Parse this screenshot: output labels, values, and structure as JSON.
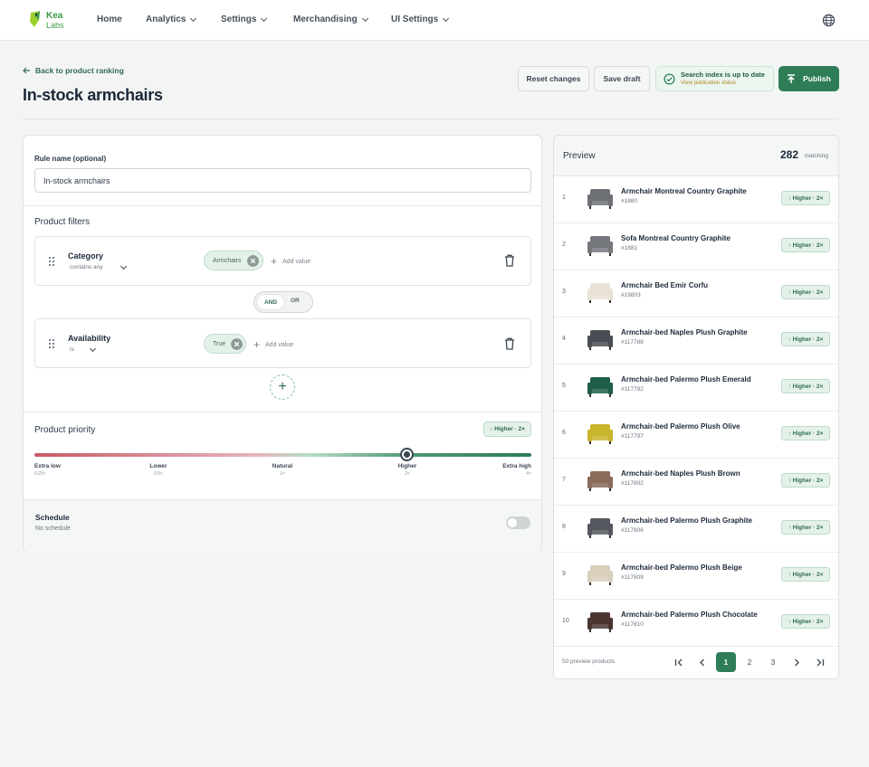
{
  "logo": {
    "line1": "Kea",
    "line2": "Labs"
  },
  "nav": {
    "home": "Home",
    "analytics": "Analytics",
    "settings": "Settings",
    "merchandising": "Merchandising",
    "ui_settings": "UI Settings"
  },
  "header": {
    "back_label": "Back to product ranking",
    "title": "In-stock armchairs",
    "reset_label": "Reset changes",
    "save_label": "Save draft",
    "status_title": "Search index is up to date",
    "status_link": "View publication status",
    "publish_label": "Publish"
  },
  "rule": {
    "name_label": "Rule name (optional)",
    "name_value": "In-stock armchairs"
  },
  "filters": {
    "section_title": "Product filters",
    "items": [
      {
        "name": "Category",
        "operator": "contains any",
        "value": "Armchairs",
        "add_label": "Add value"
      },
      {
        "name": "Availability",
        "operator": "is",
        "value": "True",
        "add_label": "Add value"
      }
    ],
    "and_label": "AND",
    "or_label": "OR"
  },
  "priority": {
    "section_title": "Product priority",
    "current_badge": "↑ Higher · 2×",
    "current_level": "Higher",
    "levels": [
      {
        "label": "Extra low",
        "factor": "0.25×"
      },
      {
        "label": "Lower",
        "factor": "0.5×"
      },
      {
        "label": "Natural",
        "factor": "1×"
      },
      {
        "label": "Higher",
        "factor": "2×"
      },
      {
        "label": "Extra high",
        "factor": "4×"
      }
    ]
  },
  "schedule": {
    "title": "Schedule",
    "subtitle": "No schedule",
    "enabled": false
  },
  "preview": {
    "title": "Preview",
    "count": "282",
    "count_label": "matching",
    "products": [
      {
        "index": "1",
        "name": "Armchair Montreal Country Graphite",
        "id": "#1880",
        "badge": "↑ Higher · 2×",
        "color": "#6d7175"
      },
      {
        "index": "2",
        "name": "Sofa Montreal Country Graphite",
        "id": "#1881",
        "badge": "↑ Higher · 2×",
        "color": "#74787c"
      },
      {
        "index": "3",
        "name": "Armchair Bed Emir Corfu",
        "id": "#19803",
        "badge": "↑ Higher · 2×",
        "color": "#e8e2d6"
      },
      {
        "index": "4",
        "name": "Armchair-bed Naples Plush Graphite",
        "id": "#117788",
        "badge": "↑ Higher · 2×",
        "color": "#4a4e54"
      },
      {
        "index": "5",
        "name": "Armchair-bed Palermo Plush Emerald",
        "id": "#117792",
        "badge": "↑ Higher · 2×",
        "color": "#1f5e48"
      },
      {
        "index": "6",
        "name": "Armchair-bed Palermo Plush Olive",
        "id": "#117797",
        "badge": "↑ Higher · 2×",
        "color": "#c9b52c"
      },
      {
        "index": "7",
        "name": "Armchair-bed Naples Plush Brown",
        "id": "#117802",
        "badge": "↑ Higher · 2×",
        "color": "#8a6a5a"
      },
      {
        "index": "8",
        "name": "Armchair-bed Palermo Plush Graphite",
        "id": "#117806",
        "badge": "↑ Higher · 2×",
        "color": "#55595f"
      },
      {
        "index": "9",
        "name": "Armchair-bed Palermo Plush Beige",
        "id": "#117809",
        "badge": "↑ Higher · 2×",
        "color": "#d8d0bd"
      },
      {
        "index": "10",
        "name": "Armchair-bed Palermo Plush Chocolate",
        "id": "#117810",
        "badge": "↑ Higher · 2×",
        "color": "#4b3530"
      }
    ],
    "footer_count": "50 preview products",
    "pages": [
      "1",
      "2",
      "3"
    ],
    "current_page": "1"
  },
  "colors": {
    "accent": "#2e7d57",
    "accent_light": "#e4f1e9",
    "warning_text": "#b4862a"
  },
  "icons": {
    "back": "arrow-left-icon",
    "globe": "globe-icon",
    "status": "check-circle-icon",
    "publish": "upload-icon",
    "grip": "drag-handle-icon",
    "remove": "close-circle-icon",
    "trash": "trash-icon",
    "add": "plus-icon"
  }
}
